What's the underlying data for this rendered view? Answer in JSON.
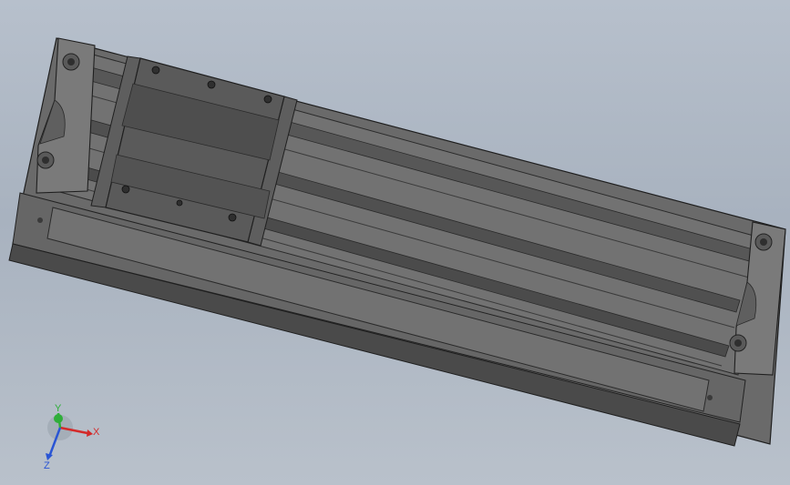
{
  "viewport": {
    "background_top": "#b7c0cc",
    "background_bottom": "#b9c1cb"
  },
  "model": {
    "description_icon": "linear-module-icon",
    "body_color": "#6b6b6b",
    "dark_color": "#3f3f3f",
    "edge_color": "#1f1f1f",
    "highlight_color": "#8a8a8a"
  },
  "triad": {
    "x_label": "X",
    "y_label": "Y",
    "z_label": "Z",
    "x_color": "#d42a2a",
    "y_color": "#2fae3a",
    "z_color": "#2a55d4"
  }
}
